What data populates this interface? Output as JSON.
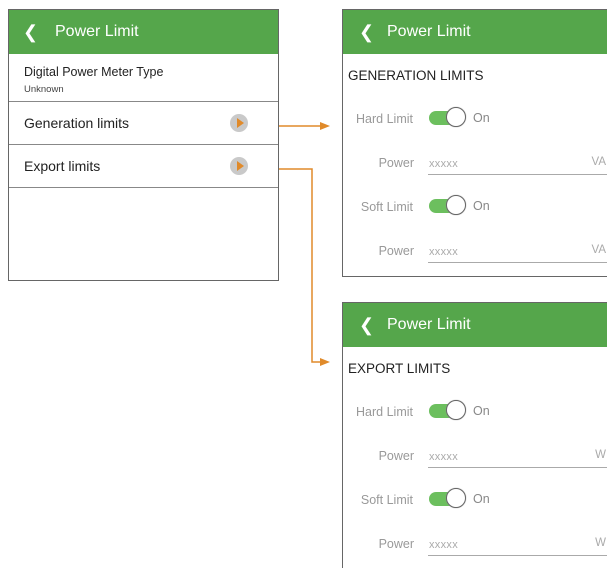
{
  "colors": {
    "header": "#55a64b",
    "toggle": "#6cbf5e",
    "arrow": "#e08a2a"
  },
  "main": {
    "title": "Power Limit",
    "meter_label": "Digital Power Meter Type",
    "meter_value": "Unknown",
    "items": [
      {
        "label": "Generation limits",
        "icon": "chevron-right-icon"
      },
      {
        "label": "Export limits",
        "icon": "chevron-right-icon"
      }
    ]
  },
  "generation": {
    "title": "Power Limit",
    "section": "GENERATION LIMITS",
    "hard_label": "Hard Limit",
    "hard_state": "On",
    "hard_power_label": "Power",
    "hard_power_value": "xxxxx",
    "hard_unit": "VA",
    "soft_label": "Soft Limit",
    "soft_state": "On",
    "soft_power_label": "Power",
    "soft_power_value": "xxxxx",
    "soft_unit": "VA"
  },
  "export": {
    "title": "Power Limit",
    "section": "EXPORT LIMITS",
    "hard_label": "Hard Limit",
    "hard_state": "On",
    "hard_power_label": "Power",
    "hard_power_value": "xxxxx",
    "hard_unit": "W",
    "soft_label": "Soft Limit",
    "soft_state": "On",
    "soft_power_label": "Power",
    "soft_power_value": "xxxxx",
    "soft_unit": "W"
  }
}
